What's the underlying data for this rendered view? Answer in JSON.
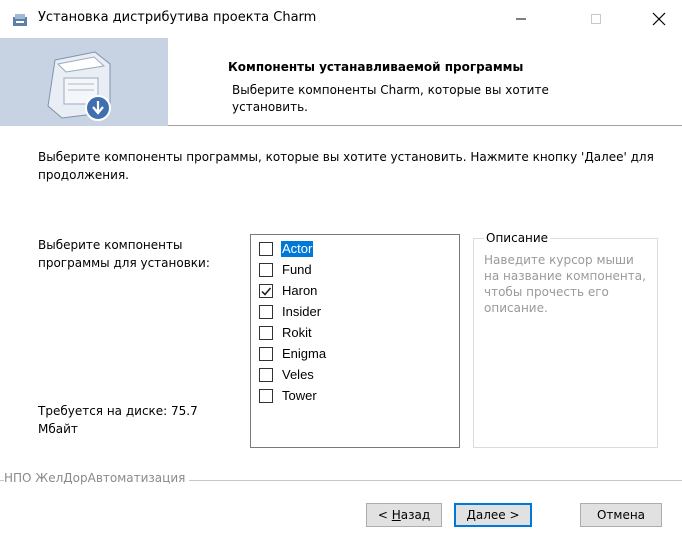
{
  "window": {
    "title": "Установка дистрибутива проекта Charm",
    "icons": {
      "app": "installer-icon",
      "minimize": "minimize-icon",
      "maximize": "maximize-icon",
      "close": "close-icon"
    }
  },
  "header": {
    "title": "Компоненты устанавливаемой программы",
    "subtitle": "Выберите компоненты Charm, которые вы хотите установить."
  },
  "intro": "Выберите компоненты программы, которые вы хотите установить. Нажмите кнопку 'Далее' для продолжения.",
  "select_label": "Выберите компоненты программы для установки:",
  "disk_space": "Требуется на диске: 75.7 Мбайт",
  "components": [
    {
      "label": "Actor",
      "checked": false,
      "selected": true
    },
    {
      "label": "Fund",
      "checked": false,
      "selected": false
    },
    {
      "label": "Haron",
      "checked": true,
      "selected": false
    },
    {
      "label": "Insider",
      "checked": false,
      "selected": false
    },
    {
      "label": "Rokit",
      "checked": false,
      "selected": false
    },
    {
      "label": "Enigma",
      "checked": false,
      "selected": false
    },
    {
      "label": "Veles",
      "checked": false,
      "selected": false
    },
    {
      "label": "Tower",
      "checked": false,
      "selected": false
    }
  ],
  "description": {
    "legend": "Описание",
    "text": "Наведите курсор мыши на название компонента, чтобы прочесть его описание."
  },
  "brand": "НПО ЖелДорАвтоматизация",
  "buttons": {
    "back_prefix": "< ",
    "back_key": "Н",
    "back_rest": "азад",
    "next_key": "Д",
    "next_rest": "алее >",
    "cancel": "Отмена"
  },
  "colors": {
    "selection": "#0078d7",
    "header_art": "#c7d3e3"
  }
}
